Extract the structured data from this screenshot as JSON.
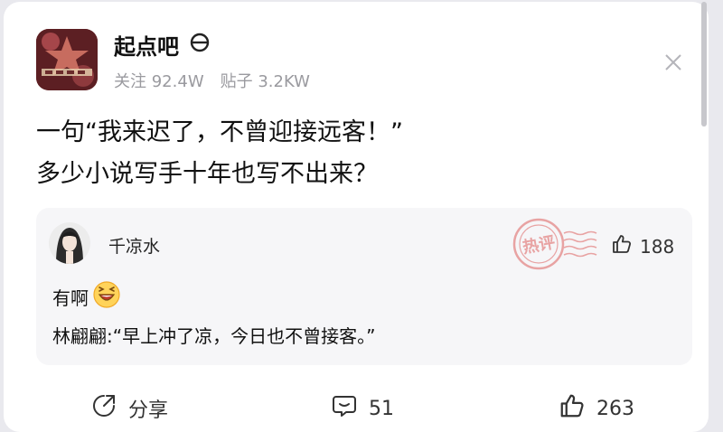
{
  "forum": {
    "name": "起点吧",
    "badge_icon": "forum-badge-icon",
    "followers_label": "关注",
    "followers": "92.4W",
    "posts_label": "贴子",
    "posts": "3.2KW"
  },
  "post": {
    "title_line1": "一句“我来迟了，不曾迎接远客！”",
    "title_line2": "多少小说写手十年也写不出来？"
  },
  "hot_comment": {
    "stamp_text": "热评",
    "user": "千凉水",
    "likes": "188",
    "line1": "有啊",
    "emoji_icon": "laughing-emoji-icon",
    "line2": "林翩翩:“早上冲了凉，今日也不曾接客。”"
  },
  "actions": {
    "share_label": "分享",
    "comments": "51",
    "likes": "263"
  },
  "colors": {
    "stamp": "#e8a3a3",
    "meta_gray": "#9a9a9f",
    "quote_bg": "#f6f6f8"
  }
}
